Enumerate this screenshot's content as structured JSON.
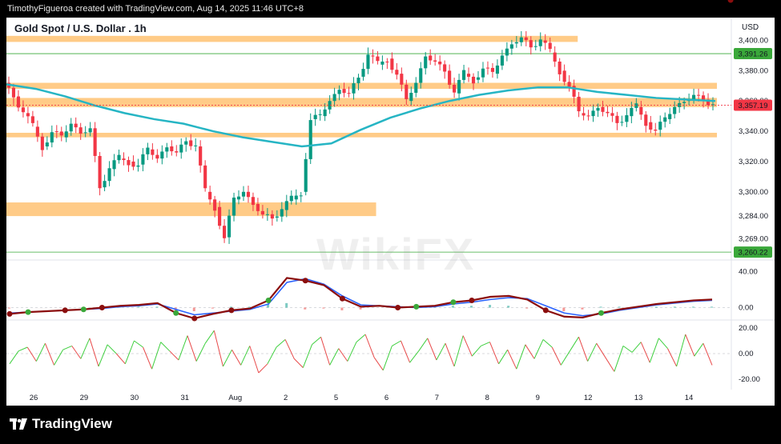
{
  "header": {
    "credit": "TimothyFigueroa created with TradingView.com, Aug 14, 2025 11:46 UTC+8"
  },
  "footer": {
    "brand": "TradingView"
  },
  "watermark": "WikiFX",
  "colors": {
    "bull": "#089981",
    "bear": "#f23645",
    "ma": "#26b5c4",
    "zone": "#ffc57a",
    "pivot_high": "#8b0e0e",
    "pivot_low": "#3aa83a"
  },
  "chart_data": {
    "type": "candlestick",
    "title": "Gold Spot / U.S. Dollar . 1h",
    "currency": "USD",
    "price_ticks": [
      "3,400.00",
      "3,380.00",
      "3,360.00",
      "3,340.00",
      "3,320.00",
      "3,300.00",
      "3,284.00",
      "3,269.00"
    ],
    "price_ylim": [
      3255,
      3414
    ],
    "x_labels": [
      "26",
      "29",
      "30",
      "31",
      "Aug",
      "2",
      "5",
      "6",
      "7",
      "8",
      "9",
      "12",
      "13",
      "14"
    ],
    "last_price": "3,357.19",
    "markers": [
      {
        "label": "3,391.26",
        "value": 3391.26
      },
      {
        "label": "3,260.22",
        "value": 3260.22
      }
    ],
    "support_resistance_zones": [
      {
        "from": 3399,
        "to": 3403,
        "start": "26",
        "end": "9"
      },
      {
        "from": 3368,
        "to": 3372,
        "start": "26",
        "end": "14"
      },
      {
        "from": 3356,
        "to": 3362,
        "start": "26",
        "end": "14"
      },
      {
        "from": 3336,
        "to": 3339,
        "start": "26",
        "end": "14"
      },
      {
        "from": 3284,
        "to": 3293,
        "start": "26",
        "end": "5"
      }
    ],
    "price_path": [
      3372,
      3363,
      3352,
      3343,
      3330,
      3340,
      3336,
      3345,
      3339,
      3342,
      3303,
      3315,
      3322,
      3320,
      3318,
      3328,
      3322,
      3330,
      3326,
      3334,
      3330,
      3300,
      3290,
      3270,
      3295,
      3300,
      3292,
      3285,
      3283,
      3288,
      3295,
      3300,
      3348,
      3350,
      3360,
      3368,
      3365,
      3376,
      3390,
      3384,
      3388,
      3378,
      3360,
      3372,
      3390,
      3386,
      3380,
      3365,
      3378,
      3374,
      3382,
      3378,
      3390,
      3398,
      3402,
      3396,
      3400,
      3392,
      3380,
      3370,
      3352,
      3350,
      3356,
      3352,
      3346,
      3350,
      3356,
      3346,
      3341,
      3348,
      3356,
      3360,
      3364,
      3361,
      3357.19
    ],
    "moving_average": [
      3371,
      3368,
      3363,
      3357,
      3352,
      3348,
      3345,
      3340,
      3336,
      3333,
      3330,
      3332,
      3341,
      3349,
      3355,
      3360,
      3364,
      3367,
      3369,
      3369,
      3366,
      3364,
      3362,
      3361,
      3360
    ],
    "oscillator_1": {
      "ticks": [
        "40.00",
        "0.00"
      ],
      "ylim": [
        -12,
        52
      ],
      "fast": [
        -7,
        -5,
        -4,
        -3,
        -2,
        0,
        2,
        3,
        5,
        -6,
        -12,
        -7,
        -3,
        -1,
        8,
        33,
        30,
        25,
        10,
        1,
        2,
        0,
        1,
        2,
        6,
        8,
        12,
        13,
        9,
        -3,
        -10,
        -11,
        -6,
        -2,
        1,
        4,
        6,
        8,
        9
      ],
      "slow": [
        -6,
        -5,
        -4,
        -3,
        -2,
        -1,
        1,
        2,
        4,
        -2,
        -8,
        -6,
        -4,
        -2,
        4,
        28,
        32,
        26,
        13,
        3,
        2,
        1,
        0,
        1,
        4,
        6,
        9,
        11,
        10,
        2,
        -6,
        -9,
        -7,
        -3,
        0,
        3,
        5,
        7,
        8
      ],
      "pivot_highs": [
        0,
        3,
        5,
        10,
        12,
        16,
        18,
        21,
        25,
        29,
        39
      ],
      "pivot_lows": [
        1,
        4,
        9,
        14,
        22,
        24,
        32
      ]
    },
    "oscillator_2": {
      "ticks": [
        "20.00",
        "0.00",
        "-20.00"
      ],
      "ylim": [
        -25,
        25
      ],
      "values": [
        -8,
        2,
        5,
        -6,
        8,
        -9,
        3,
        6,
        -4,
        12,
        -10,
        7,
        0,
        -8,
        10,
        5,
        -12,
        9,
        2,
        -5,
        14,
        -6,
        8,
        18,
        -10,
        3,
        -9,
        6,
        -15,
        -8,
        5,
        11,
        -4,
        -11,
        7,
        13,
        -9,
        4,
        -6,
        9,
        15,
        -3,
        -13,
        6,
        10,
        -7,
        2,
        12,
        -5,
        8,
        -10,
        14,
        -2,
        6,
        9,
        -8,
        3,
        -12,
        7,
        -4,
        11,
        5,
        -9,
        2,
        13,
        -6,
        8,
        -3,
        -14,
        6,
        1,
        9,
        -7,
        12,
        4,
        -10,
        15,
        -2,
        8,
        -9
      ]
    }
  }
}
